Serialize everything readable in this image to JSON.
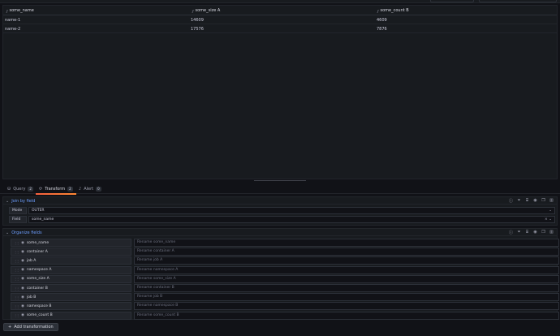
{
  "table": {
    "columns": [
      {
        "label": "some_name",
        "type_icon": "function-icon",
        "has_icon": true
      },
      {
        "label": "some_size A",
        "type_icon": "function-icon"
      },
      {
        "label": "some_count B",
        "type_icon": "function-icon"
      }
    ],
    "rows": [
      [
        "name-1",
        "14609",
        "4609"
      ],
      [
        "name-2",
        "17576",
        "7876"
      ]
    ]
  },
  "tabs": [
    {
      "label": "Query",
      "count": "2",
      "icon": "database-icon"
    },
    {
      "label": "Transform",
      "count": "2",
      "icon": "transform-icon",
      "active": true
    },
    {
      "label": "Alert",
      "count": "0",
      "icon": "bell-icon"
    }
  ],
  "join": {
    "title": "Join by field",
    "mode_label": "Mode",
    "mode_value": "OUTER",
    "field_label": "Field",
    "field_value": "some_name"
  },
  "organize": {
    "title": "Organize fields",
    "fields": [
      {
        "name": "some_name",
        "placeholder": "Rename some_name"
      },
      {
        "name": "container A",
        "placeholder": "Rename container A"
      },
      {
        "name": "job A",
        "placeholder": "Rename job A"
      },
      {
        "name": "namespace A",
        "placeholder": "Rename namespace A"
      },
      {
        "name": "some_size A",
        "placeholder": "Rename some_size A"
      },
      {
        "name": "container B",
        "placeholder": "Rename container B"
      },
      {
        "name": "job B",
        "placeholder": "Rename job B"
      },
      {
        "name": "namespace B",
        "placeholder": "Rename namespace B"
      },
      {
        "name": "some_count B",
        "placeholder": "Rename some_count B"
      }
    ]
  },
  "add_button": {
    "label": "Add transformation"
  },
  "colors": {
    "accent_blue": "#6e9fff",
    "tab_underline": "#ff7733",
    "background": "#111217",
    "panel": "#181b1f"
  }
}
